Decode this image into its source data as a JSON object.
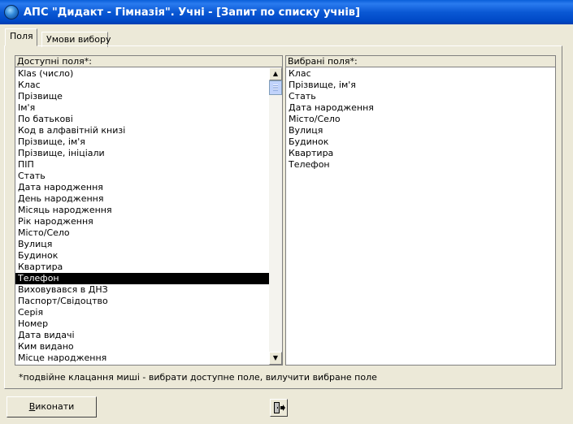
{
  "window": {
    "title": "АПС \"Дидакт - Гімназія\". Учні - [Запит по списку учнів]",
    "icon": "globe-icon"
  },
  "tabs": [
    {
      "label": "Поля",
      "active": true
    },
    {
      "label": "Умови вибору",
      "active": false
    }
  ],
  "available_fields": {
    "label": "Доступні поля*:",
    "selected_index": 18,
    "items": [
      "Klas (число)",
      "Клас",
      "Прізвище",
      "Ім'я",
      "По батькові",
      "Код в алфавітній книзі",
      "Прізвище, ім'я",
      "Прізвище, ініціали",
      "ПІП",
      "Стать",
      "Дата народження",
      "День народження",
      "Місяць народження",
      "Рік народження",
      "Місто/Село",
      "Вулиця",
      "Будинок",
      "Квартира",
      "Телефон",
      "Виховувався в ДНЗ",
      "Паспорт/Свідоцтво",
      "Серія",
      "Номер",
      "Дата видачі",
      "Ким видано",
      "Місце народження"
    ]
  },
  "selected_fields": {
    "label": "Вибрані поля*:",
    "items": [
      "Клас",
      "Прізвище, ім'я",
      "Стать",
      "Дата народження",
      "Місто/Село",
      "Вулиця",
      "Будинок",
      "Квартира",
      "Телефон"
    ]
  },
  "hint": "*подвійне клацання миші - вибрати доступне поле, вилучити вибране поле",
  "buttons": {
    "run_prefix": "",
    "run_accel": "В",
    "run_rest": "иконати",
    "exit_icon": "exit-door-icon"
  },
  "colors": {
    "titlebar": "#0a58d4",
    "face": "#ece9d8",
    "selection": "#000000"
  }
}
